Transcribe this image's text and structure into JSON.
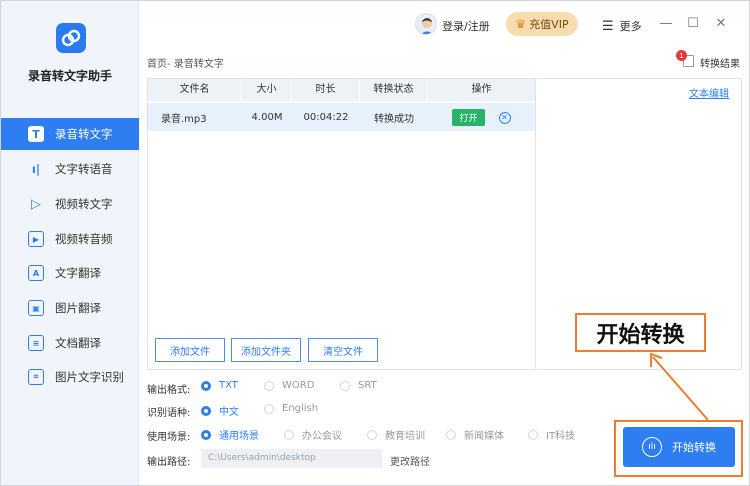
{
  "app": {
    "title": "录音转文字助手"
  },
  "sidebar": {
    "items": [
      {
        "label": "录音转文字",
        "icon": "T",
        "active": true
      },
      {
        "label": "文字转语音",
        "icon": "ı|"
      },
      {
        "label": "视频转文字",
        "icon": "▷"
      },
      {
        "label": "视频转音频",
        "icon": "▶"
      },
      {
        "label": "文字翻译",
        "icon": "A"
      },
      {
        "label": "图片翻译",
        "icon": "▣"
      },
      {
        "label": "文档翻译",
        "icon": "≡"
      },
      {
        "label": "图片文字识别",
        "icon": "⌗"
      }
    ]
  },
  "topbar": {
    "login": "登录/注册",
    "vip": "充值VIP",
    "more": "更多"
  },
  "breadcrumb": "首页- 录音转文字",
  "result": {
    "label": "转换结果",
    "badge": "1"
  },
  "table": {
    "headers": [
      "文件名",
      "大小",
      "时长",
      "转换状态",
      "操作"
    ],
    "rows": [
      {
        "name": "录音.mp3",
        "size": "4.00M",
        "duration": "00:04:22",
        "status": "转换成功",
        "open": "打开"
      }
    ]
  },
  "buttons": {
    "add_file": "添加文件",
    "add_folder": "添加文件夹",
    "clear": "清空文件"
  },
  "text_edit": "文本编辑",
  "options": {
    "output_format": {
      "label": "输出格式:",
      "choices": [
        "TXT",
        "WORD",
        "SRT"
      ],
      "selected": "TXT"
    },
    "language": {
      "label": "识别语种:",
      "choices": [
        "中文",
        "English"
      ],
      "selected": "中文"
    },
    "scene": {
      "label": "使用场景:",
      "choices": [
        "通用场景",
        "办公会议",
        "教育培训",
        "新闻媒体",
        "IT科技"
      ],
      "selected": "通用场景"
    },
    "output_path": {
      "label": "输出路径:",
      "value": "C:\\Users\\admin\\desktop",
      "change": "更改路径"
    }
  },
  "start_button": "开始转换",
  "callout": "开始转换"
}
